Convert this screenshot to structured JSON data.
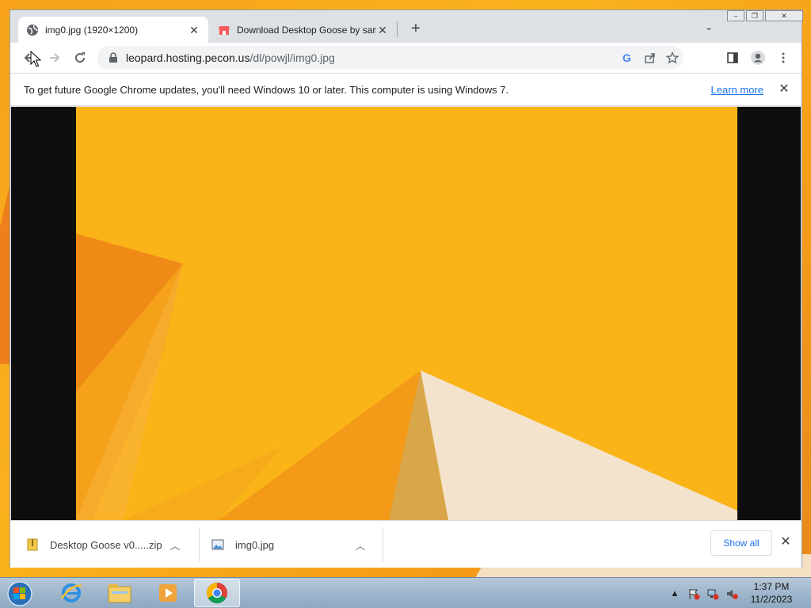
{
  "tabs": [
    {
      "title": "img0.jpg (1920×1200)",
      "favicon": "globe-icon",
      "active": true
    },
    {
      "title": "Download Desktop Goose by samperson",
      "favicon": "itchio-icon",
      "active": false
    }
  ],
  "omnibox": {
    "domain": "leopard.hosting.pecon.us",
    "path": "/dl/powjl/img0.jpg"
  },
  "infobar": {
    "message": "To get future Google Chrome updates, you'll need Windows 10 or later. This computer is using Windows 7.",
    "link": "Learn more"
  },
  "downloads": {
    "items": [
      {
        "name": "Desktop Goose v0.....zip",
        "icon": "zip-file-icon"
      },
      {
        "name": "img0.jpg",
        "icon": "image-file-icon"
      }
    ],
    "show_all": "Show all"
  },
  "taskbar": {
    "apps": [
      "internet-explorer-icon",
      "file-explorer-icon",
      "media-player-icon",
      "chrome-icon"
    ],
    "clock_time": "1:37 PM",
    "clock_date": "11/2/2023"
  },
  "colors": {
    "accent": "#1a73e8",
    "wallpaper": "#f9b418"
  }
}
